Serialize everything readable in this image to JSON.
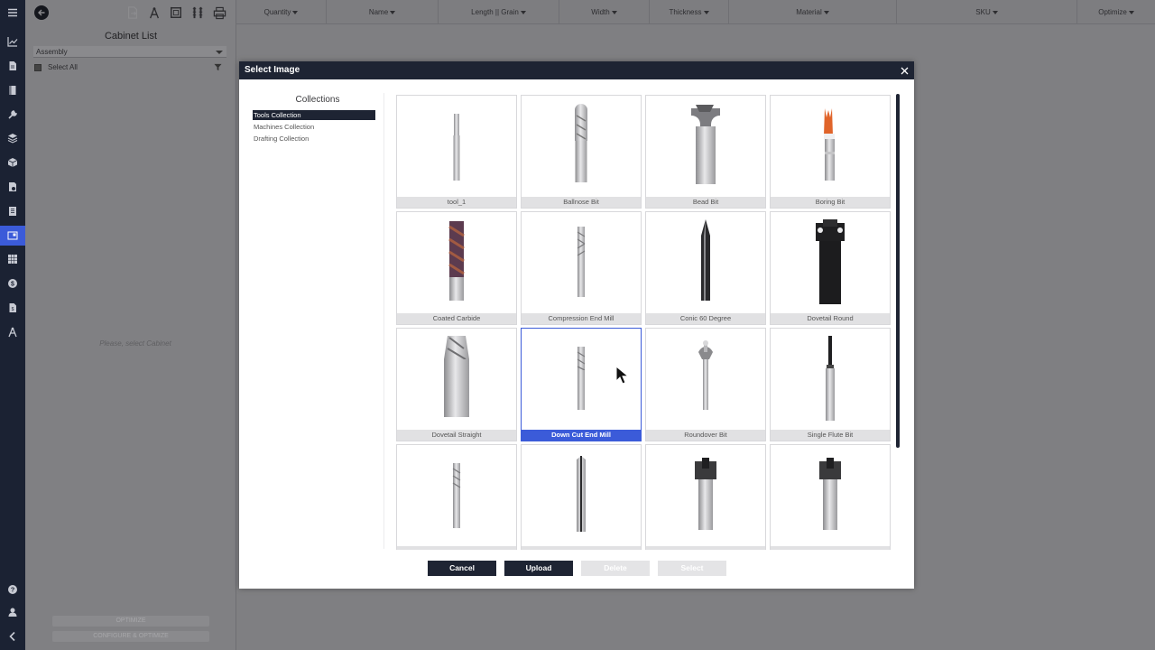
{
  "header": {
    "columns": [
      {
        "label": "Quantity"
      },
      {
        "label": "Name"
      },
      {
        "label": "Length || Grain"
      },
      {
        "label": "Width"
      },
      {
        "label": "Thickness"
      },
      {
        "label": "Material"
      },
      {
        "label": "SKU"
      },
      {
        "label": "Optimize"
      }
    ]
  },
  "cabinet_panel": {
    "title": "Cabinet List",
    "assembly_value": "Assembly",
    "select_all_label": "Select All",
    "empty_message": "Please, select Cabinet",
    "optimize_label": "OPTIMIZE",
    "configure_label": "CONFIGURE & OPTIMIZE"
  },
  "modal": {
    "title": "Select Image",
    "collections_title": "Collections",
    "collections": [
      {
        "label": "Tools Collection",
        "active": true
      },
      {
        "label": "Machines Collection",
        "active": false
      },
      {
        "label": "Drafting Collection",
        "active": false
      }
    ],
    "images": [
      {
        "label": "tool_1",
        "icon": "straight-bit-icon"
      },
      {
        "label": "Ballnose Bit",
        "icon": "ballnose-bit-icon"
      },
      {
        "label": "Bead Bit",
        "icon": "bead-bit-icon"
      },
      {
        "label": "Boring Bit",
        "icon": "boring-bit-icon"
      },
      {
        "label": "Coated Carbide",
        "icon": "coated-carbide-icon"
      },
      {
        "label": "Compression End Mill",
        "icon": "compression-end-mill-icon"
      },
      {
        "label": "Conic 60 Degree",
        "icon": "conic-bit-icon"
      },
      {
        "label": "Dovetail Round",
        "icon": "dovetail-round-icon"
      },
      {
        "label": "Dovetail Straight",
        "icon": "dovetail-straight-icon"
      },
      {
        "label": "Down Cut End Mill",
        "icon": "down-cut-end-mill-icon",
        "selected": true
      },
      {
        "label": "Roundover Bit",
        "icon": "roundover-bit-icon"
      },
      {
        "label": "Single Flute Bit",
        "icon": "single-flute-bit-icon"
      },
      {
        "label": "",
        "icon": "spiral-bit-icon"
      },
      {
        "label": "",
        "icon": "straight-carbide-bit-icon"
      },
      {
        "label": "",
        "icon": "insert-cutter-icon"
      },
      {
        "label": "",
        "icon": "insert-cutter-icon"
      }
    ],
    "buttons": {
      "cancel": "Cancel",
      "upload": "Upload",
      "delete": "Delete",
      "select": "Select"
    }
  },
  "colors": {
    "accent": "#3b5bd9",
    "dark": "#1e2433"
  }
}
